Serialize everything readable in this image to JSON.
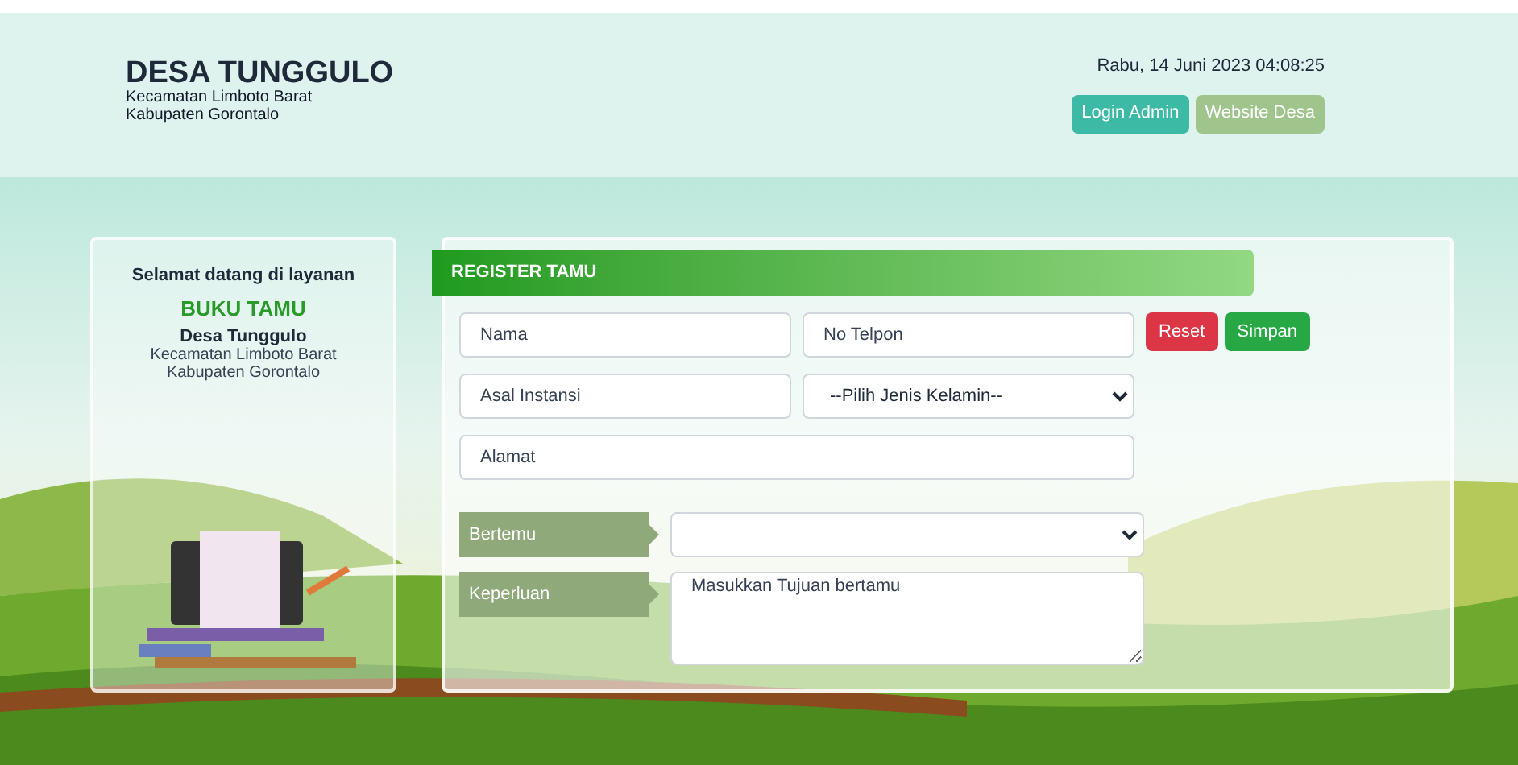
{
  "header": {
    "title": "DESA TUNGGULO",
    "subtitle_lines": [
      "Kecamatan Limboto Barat",
      "Kabupaten Gorontalo"
    ],
    "datetime": "Rabu, 14 Juni 2023 04:08:25",
    "buttons": [
      {
        "label": "Login Admin",
        "color": "#3dbaa6"
      },
      {
        "label": "Website Desa",
        "color": "#9fc48c"
      }
    ]
  },
  "welcome_card": {
    "greeting": "Selamat datang di layanan",
    "service": "BUKU TAMU",
    "village": "Desa Tunggulo",
    "address_lines": [
      "Kecamatan Limboto Barat",
      "Kabupaten Gorontalo"
    ]
  },
  "form": {
    "title": "REGISTER TAMU",
    "fields": [
      {
        "kind": "input",
        "placeholder": "Nama"
      },
      {
        "kind": "input",
        "placeholder": "No Telpon"
      },
      {
        "kind": "input",
        "placeholder": "Asal Instansi"
      },
      {
        "kind": "select",
        "value": "--Pilih Jenis Kelamin--"
      },
      {
        "kind": "input",
        "placeholder": "Alamat",
        "wide": true
      }
    ],
    "buttons": [
      {
        "label": "Reset",
        "color": "#dc3545"
      },
      {
        "label": "Simpan",
        "color": "#28a745"
      }
    ],
    "labeled_fields": [
      {
        "label": "Bertemu",
        "kind": "select"
      },
      {
        "label": "Keperluan",
        "kind": "textarea",
        "placeholder": "Masukkan Tujuan bertamu"
      }
    ]
  }
}
